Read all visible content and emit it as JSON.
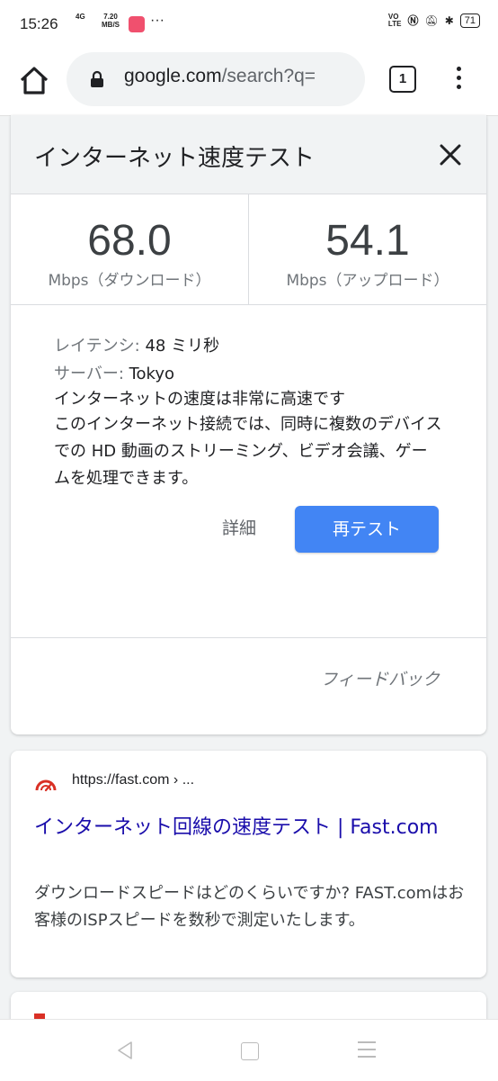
{
  "status_bar": {
    "time": "15:26",
    "network": "4G",
    "net_speed_value": "7.20",
    "net_speed_unit": "MB/S",
    "more": "···",
    "volte": "VO\nLTE",
    "battery": "71"
  },
  "browser": {
    "url_host": "google.com",
    "url_rest": "/search?q=",
    "tab_count": "1"
  },
  "speed_test": {
    "title": "インターネット速度テスト",
    "download_value": "68.0",
    "download_label": "Mbps（ダウンロード）",
    "upload_value": "54.1",
    "upload_label": "Mbps（アップロード）",
    "latency_label": "レイテンシ:",
    "latency_value": " 48 ミリ秒",
    "server_label": "サーバー:",
    "server_value": " Tokyo",
    "quality": "インターネットの速度は非常に高速です",
    "description": "このインターネット接続では、同時に複数のデバイスでの HD 動画のストリーミング、ビデオ会議、ゲームを処理できます。",
    "details_button": "詳細",
    "retest_button": "再テスト",
    "feedback": "フィードバック"
  },
  "result": {
    "source": "https://fast.com › ...",
    "title": "インターネット回線の速度テスト | Fast.com",
    "snippet": "ダウンロードスピードはどのくらいですか? FAST.comはお客様のISPスピードを数秒で測定いたします。"
  },
  "colors": {
    "accent": "#4285f4",
    "link": "#1a0dab",
    "fast_logo": "#d93025"
  }
}
